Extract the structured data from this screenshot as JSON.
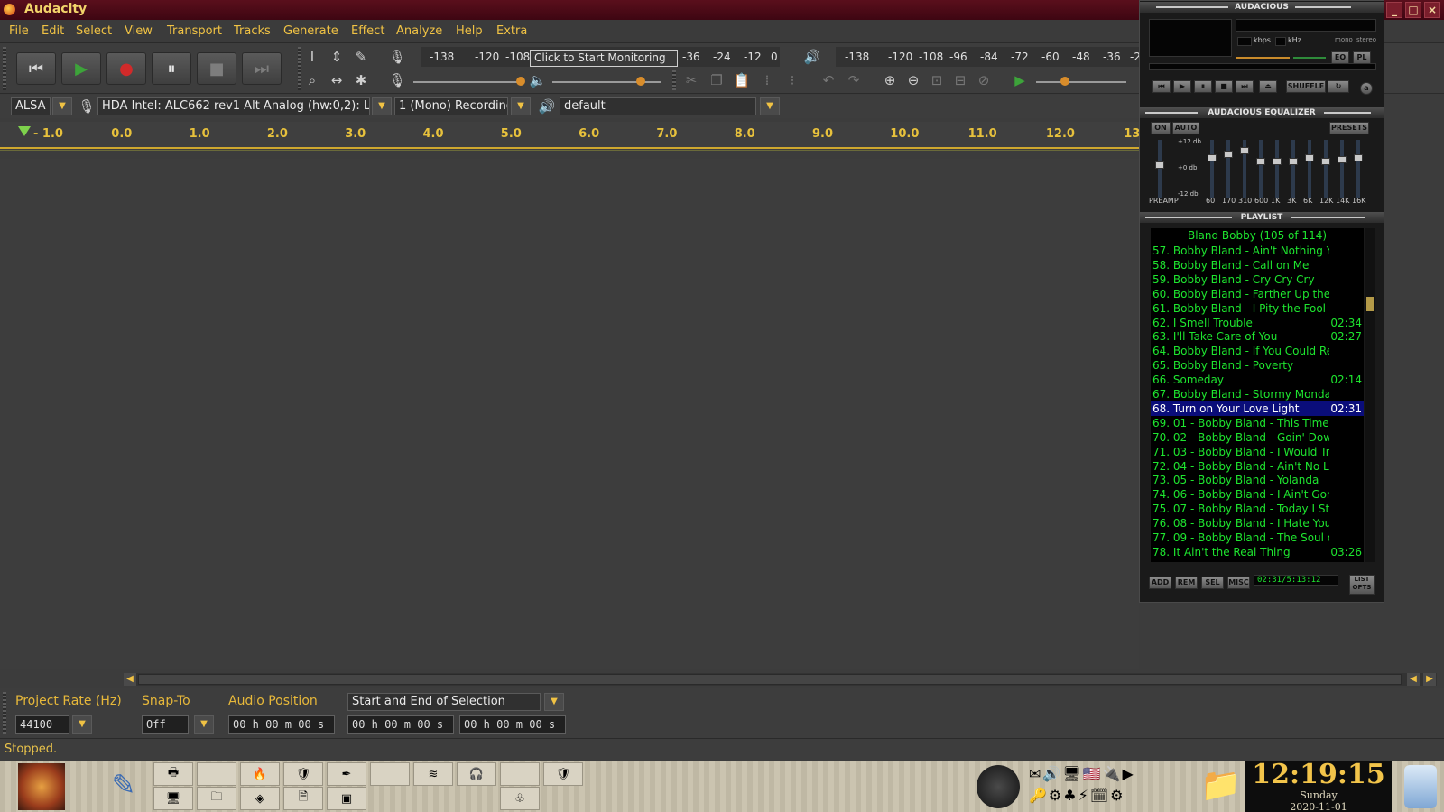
{
  "window": {
    "title": "Audacity",
    "controls": [
      "_",
      "□",
      "×"
    ]
  },
  "menu": [
    "File",
    "Edit",
    "Select",
    "View",
    "Transport",
    "Tracks",
    "Generate",
    "Effect",
    "Analyze",
    "Help",
    "Extra"
  ],
  "transport": {
    "buttons": [
      {
        "name": "skip-start-button",
        "icon": "skip-to-start-icon",
        "glyph": "⏮",
        "color": "#d6d6d6"
      },
      {
        "name": "play-button",
        "icon": "play-icon",
        "glyph": "▶",
        "color": "#3da33a"
      },
      {
        "name": "record-button",
        "icon": "record-icon",
        "glyph": "●",
        "color": "#d12a2a"
      },
      {
        "name": "pause-button",
        "icon": "pause-icon",
        "glyph": "⏸",
        "color": "#e6e6e6"
      },
      {
        "name": "stop-button",
        "icon": "stop-icon",
        "glyph": "■",
        "color": "#7d7d7d"
      },
      {
        "name": "skip-end-button",
        "icon": "skip-to-end-icon",
        "glyph": "⏭",
        "color": "#7d7d7d"
      }
    ]
  },
  "meters": {
    "record_scale": [
      "-138",
      "-120",
      "-108",
      "-36",
      "-24",
      "-12",
      "0"
    ],
    "monitor_tip": "Click to Start Monitoring",
    "play_scale": [
      "-138",
      "-120",
      "-108",
      "-96",
      "-84",
      "-72",
      "-60",
      "-48",
      "-36",
      "-2"
    ]
  },
  "device": {
    "host": "ALSA",
    "input": "HDA Intel: ALC662 rev1 Alt Analog (hw:0,2): L",
    "channels": "1 (Mono) Recording",
    "output": "default"
  },
  "ruler": [
    "- 1.0",
    "0.0",
    "1.0",
    "2.0",
    "3.0",
    "4.0",
    "5.0",
    "6.0",
    "7.0",
    "8.0",
    "9.0",
    "10.0",
    "11.0",
    "12.0",
    "13"
  ],
  "selection": {
    "project_rate_label": "Project Rate (Hz)",
    "snap_label": "Snap-To",
    "audio_position_label": "Audio Position",
    "range_mode": "Start and End of Selection",
    "project_rate": "44100",
    "snap": "Off",
    "audio_position": "00 h 00 m 00 s",
    "sel_start": "00 h 00 m 00 s",
    "sel_end": "00 h 00 m 00 s"
  },
  "status": "Stopped.",
  "audacious": {
    "main_title": "AUDACIOUS",
    "eq_title": "AUDACIOUS EQUALIZER",
    "playlist_title": "PLAYLIST",
    "kbps_label": "kbps",
    "khz_label": "kHz",
    "mono_label": "mono",
    "stereo_label": "stereo",
    "shuffle_label": "SHUFFLE",
    "eq_on": "ON",
    "eq_auto": "AUTO",
    "eq_presets": "PRESETS",
    "eq_bands": [
      "PREAMP",
      "60",
      "170",
      "310",
      "600",
      "1K",
      "3K",
      "6K",
      "12K",
      "14K",
      "16K"
    ],
    "eq_db": [
      "+12 db",
      "+0 db",
      "-12 db"
    ],
    "playlist_header": "Bland Bobby (105 of 114)",
    "playlist": [
      {
        "title": "57. Bobby Bland - Ain't Nothing Y...",
        "dur": ""
      },
      {
        "title": "58. Bobby Bland - Call on Me",
        "dur": ""
      },
      {
        "title": "59. Bobby Bland - Cry Cry Cry",
        "dur": ""
      },
      {
        "title": "60. Bobby Bland - Farther Up the ...",
        "dur": ""
      },
      {
        "title": "61. Bobby Bland - I Pity the Fool",
        "dur": ""
      },
      {
        "title": "62. I Smell Trouble",
        "dur": "02:34"
      },
      {
        "title": "63. I'll Take Care of You",
        "dur": "02:27"
      },
      {
        "title": "64. Bobby Bland - If You Could Re...",
        "dur": ""
      },
      {
        "title": "65. Bobby Bland - Poverty",
        "dur": ""
      },
      {
        "title": "66. Someday",
        "dur": "02:14"
      },
      {
        "title": "67. Bobby Bland - Stormy Monday",
        "dur": ""
      },
      {
        "title": "68. Turn on Your Love Light",
        "dur": "02:31"
      },
      {
        "title": "69. 01 - Bobby Bland - This Time I...",
        "dur": ""
      },
      {
        "title": "70. 02 - Bobby Bland - Goin' Dow...",
        "dur": ""
      },
      {
        "title": "71. 03 - Bobby Bland - I Would Tr...",
        "dur": ""
      },
      {
        "title": "72. 04 - Bobby Bland - Ain't No Lo...",
        "dur": ""
      },
      {
        "title": "73. 05 - Bobby Bland - Yolanda",
        "dur": ""
      },
      {
        "title": "74. 06 - Bobby Bland - I Ain't Gon...",
        "dur": ""
      },
      {
        "title": "75. 07 - Bobby Bland - Today I Sta...",
        "dur": ""
      },
      {
        "title": "76. 08 - Bobby Bland - I Hate You",
        "dur": ""
      },
      {
        "title": "77. 09 - Bobby Bland - The Soul of...",
        "dur": ""
      },
      {
        "title": "78. It Ain't the Real Thing",
        "dur": "03:26"
      }
    ],
    "selected_row": 11,
    "pl_buttons": [
      "ADD",
      "REM",
      "SEL",
      "MISC"
    ],
    "pl_time": "02:31/5:13:12",
    "list_opts": "LIST OPTS"
  },
  "clock": {
    "time": "12:19:15",
    "day": "Sunday",
    "date": "2020-11-01"
  },
  "colors": {
    "accent": "#f0c244",
    "playlist_text": "#1ee52f",
    "playlist_selected_bg": "#0a0d7a"
  }
}
